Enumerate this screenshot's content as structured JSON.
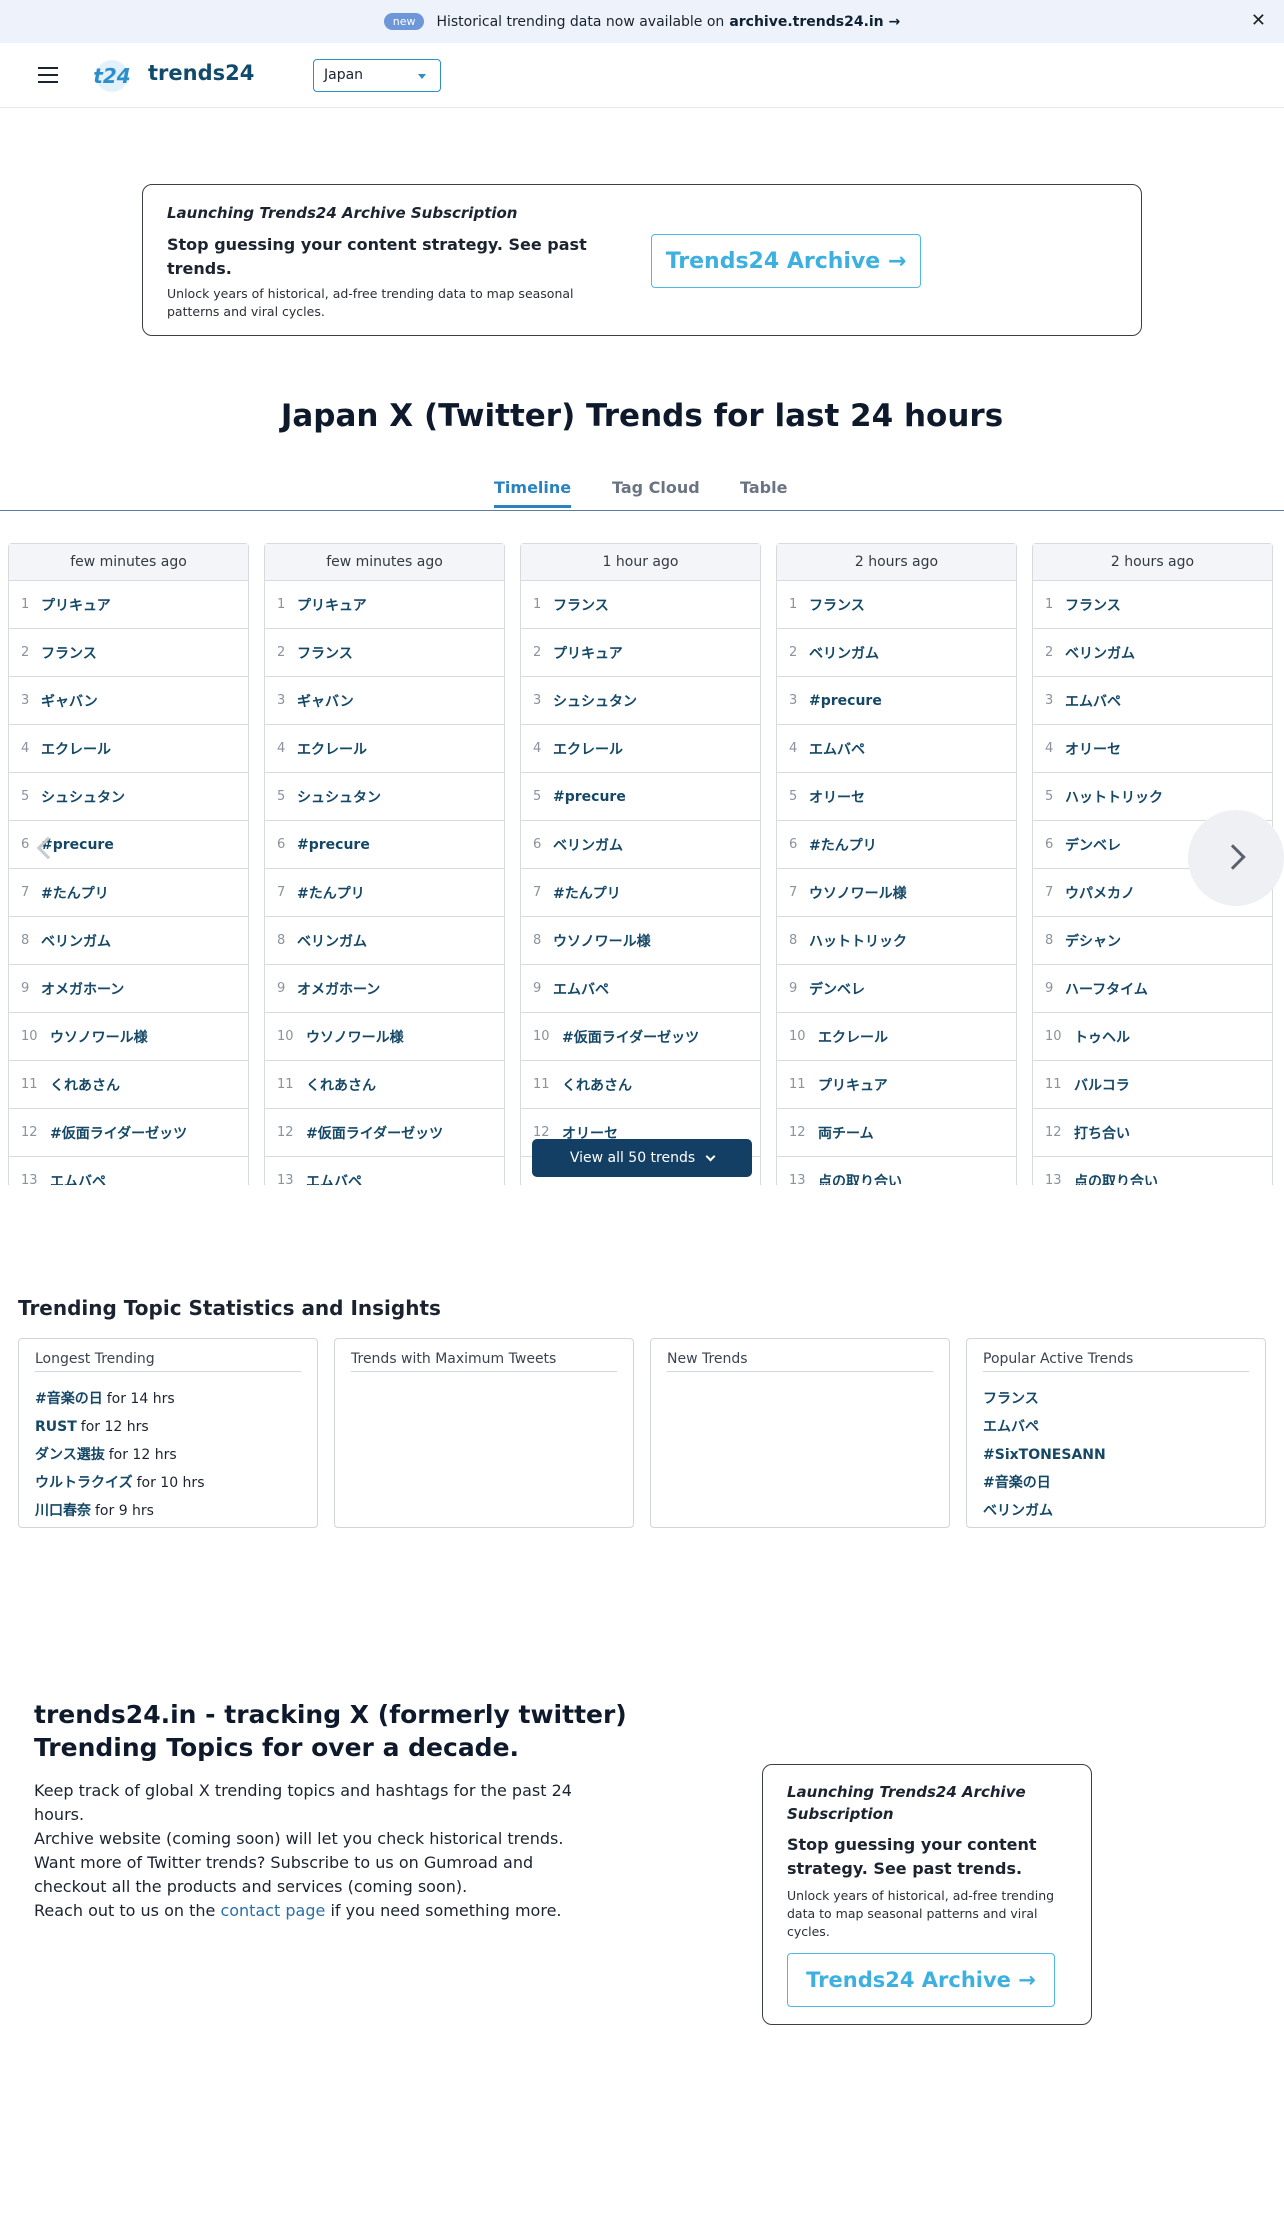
{
  "announcement": {
    "badge": "new",
    "text": "Historical trending data now available on",
    "link": "archive.trends24.in →"
  },
  "header": {
    "logo_mark": "t24",
    "logo_text": "trends24",
    "country": "Japan"
  },
  "promo": {
    "tagline": "Launching Trends24 Archive Subscription",
    "headline": "Stop guessing your content strategy. See past trends.",
    "sub": "Unlock years of historical, ad-free trending data to map seasonal patterns and viral cycles.",
    "button": "Trends24 Archive →"
  },
  "page_title": "Japan X (Twitter) Trends for last 24 hours",
  "tabs": [
    "Timeline",
    "Tag Cloud",
    "Table"
  ],
  "timeline": {
    "view_all": "View all 50 trends",
    "columns": [
      {
        "time": "few minutes ago",
        "trends": [
          "プリキュア",
          "フランス",
          "ギャバン",
          "エクレール",
          "シュシュタン",
          "#precure",
          "#たんプリ",
          "ベリンガム",
          "オメガホーン",
          "ウソノワール様",
          "くれあさん",
          "#仮面ライダーゼッツ",
          "エムバペ"
        ]
      },
      {
        "time": "few minutes ago",
        "trends": [
          "プリキュア",
          "フランス",
          "ギャバン",
          "エクレール",
          "シュシュタン",
          "#precure",
          "#たんプリ",
          "ベリンガム",
          "オメガホーン",
          "ウソノワール様",
          "くれあさん",
          "#仮面ライダーゼッツ",
          "エムバペ"
        ]
      },
      {
        "time": "1 hour ago",
        "trends": [
          "フランス",
          "プリキュア",
          "シュシュタン",
          "エクレール",
          "#precure",
          "ベリンガム",
          "#たんプリ",
          "ウソノワール様",
          "エムバペ",
          "#仮面ライダーゼッツ",
          "くれあさん",
          "オリーセ"
        ]
      },
      {
        "time": "2 hours ago",
        "trends": [
          "フランス",
          "ベリンガム",
          "#precure",
          "エムバペ",
          "オリーセ",
          "#たんプリ",
          "ウソノワール様",
          "ハットトリック",
          "デンベレ",
          "エクレール",
          "プリキュア",
          "両チーム",
          "点の取り合い"
        ]
      },
      {
        "time": "2 hours ago",
        "trends": [
          "フランス",
          "ベリンガム",
          "エムバペ",
          "オリーセ",
          "ハットトリック",
          "デンベレ",
          "ウパメカノ",
          "デシャン",
          "ハーフタイム",
          "トゥヘル",
          "バルコラ",
          "打ち合い",
          "点の取り合い"
        ]
      }
    ]
  },
  "stats": {
    "title": "Trending Topic Statistics and Insights",
    "cards": [
      {
        "title": "Longest Trending",
        "items": [
          {
            "name": "#音楽の日",
            "suffix": "for 14 hrs"
          },
          {
            "name": "RUST",
            "suffix": "for 12 hrs"
          },
          {
            "name": "ダンス選抜",
            "suffix": "for 12 hrs"
          },
          {
            "name": "ウルトラクイズ",
            "suffix": "for 10 hrs"
          },
          {
            "name": "川口春奈",
            "suffix": "for 9 hrs"
          }
        ]
      },
      {
        "title": "Trends with Maximum Tweets",
        "items": []
      },
      {
        "title": "New Trends",
        "items": []
      },
      {
        "title": "Popular Active Trends",
        "items": [
          {
            "name": "フランス",
            "suffix": ""
          },
          {
            "name": "エムバペ",
            "suffix": ""
          },
          {
            "name": "#SixTONESANN",
            "suffix": ""
          },
          {
            "name": "#音楽の日",
            "suffix": ""
          },
          {
            "name": "ベリンガム",
            "suffix": ""
          }
        ]
      }
    ]
  },
  "about": {
    "title": "trends24.in - tracking X (formerly twitter) Trending Topics for over a decade.",
    "line1": "Keep track of global X trending topics and hashtags for the past 24 hours.",
    "line2": "Archive website (coming soon) will let you check historical trends.",
    "line3": "Want more of Twitter trends? Subscribe to us on Gumroad and checkout all the products and services (coming soon).",
    "line4_pre": "Reach out to us on the",
    "line4_link": "contact page",
    "line4_post": "if you need something more."
  }
}
